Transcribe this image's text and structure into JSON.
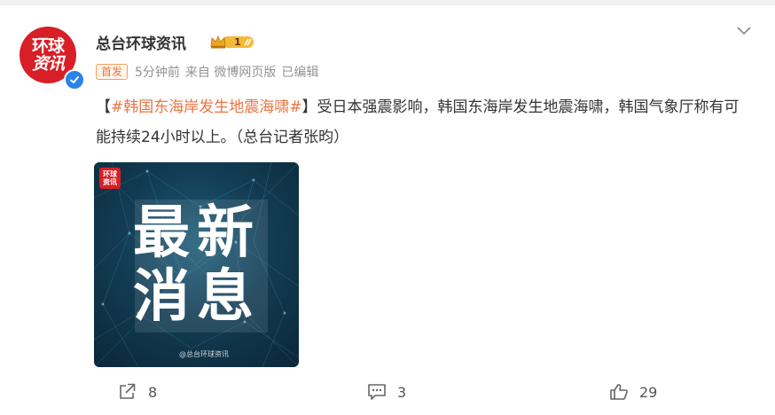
{
  "post": {
    "author": "总台环球资讯",
    "vip_level": "1",
    "first_post_badge": "首发",
    "time": "5分钟前",
    "source": "来自 微博网页版",
    "edited": "已编辑",
    "text_open": "【",
    "topic": "#韩国东海岸发生地震海啸#",
    "text_body": "】受日本强震影响，韩国东海岸发生地震海啸，韩国气象厅称有可能持续24小时以上。（总台记者张昀）",
    "avatar_logo": {
      "line1": "环球",
      "line2": "资讯"
    }
  },
  "media": {
    "headline_line1": "最新",
    "headline_line2": "消息",
    "watermark": "@总台环球资讯",
    "mini_logo": {
      "line1": "环球",
      "line2": "资讯"
    }
  },
  "actions": {
    "share_count": "8",
    "comment_count": "3",
    "like_count": "29"
  },
  "colors": {
    "accent_topic": "#eb7340",
    "verify_blue": "#2a83e8",
    "brand_red": "#d81e26"
  },
  "icons": [
    "verified-icon",
    "vip-crown-icon",
    "chevron-down-icon",
    "share-icon",
    "comment-icon",
    "like-icon"
  ]
}
